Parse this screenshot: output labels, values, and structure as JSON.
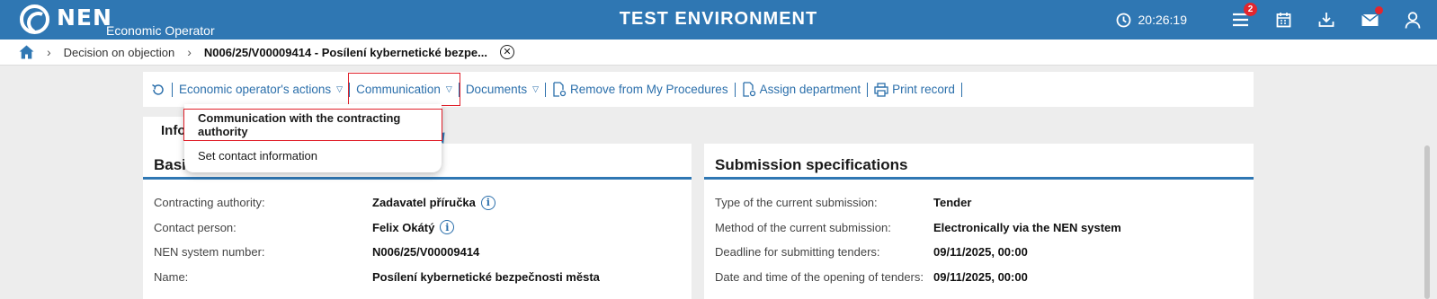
{
  "header": {
    "logo_text": "NEN",
    "logo_subtitle": "Economic Operator",
    "environment_title": "TEST ENVIRONMENT",
    "clock": "20:26:19",
    "menu_badge": "2"
  },
  "breadcrumb": {
    "items": [
      "Decision on objection",
      "N006/25/V00009414 - Posílení kybernetické bezpe..."
    ]
  },
  "toolbar": {
    "economic_actions": "Economic operator's actions",
    "communication": "Communication",
    "documents": "Documents",
    "remove": "Remove from My Procedures",
    "assign": "Assign department",
    "print": "Print record"
  },
  "tab": {
    "label": "Info"
  },
  "dropdown": {
    "items": [
      "Communication with the contracting authority",
      "Set contact information"
    ]
  },
  "basic_panel": {
    "title": "Basic information",
    "rows": [
      {
        "label": "Contracting authority:",
        "value": "Zadavatel příručka"
      },
      {
        "label": "Contact person:",
        "value": "Felix Okátý"
      },
      {
        "label": "NEN system number:",
        "value": "N006/25/V00009414"
      },
      {
        "label": "Name:",
        "value": "Posílení kybernetické bezpečnosti města"
      }
    ]
  },
  "submission_panel": {
    "title": "Submission specifications",
    "rows": [
      {
        "label": "Type of the current submission:",
        "value": "Tender"
      },
      {
        "label": "Method of the current submission:",
        "value": "Electronically via the NEN system"
      },
      {
        "label": "Deadline for submitting tenders:",
        "value": "09/11/2025, 00:00"
      },
      {
        "label": "Date and time of the opening of tenders:",
        "value": "09/11/2025, 00:00"
      }
    ]
  },
  "colors": {
    "brand_blue": "#2f77b3",
    "alert_red": "#e3262e"
  }
}
